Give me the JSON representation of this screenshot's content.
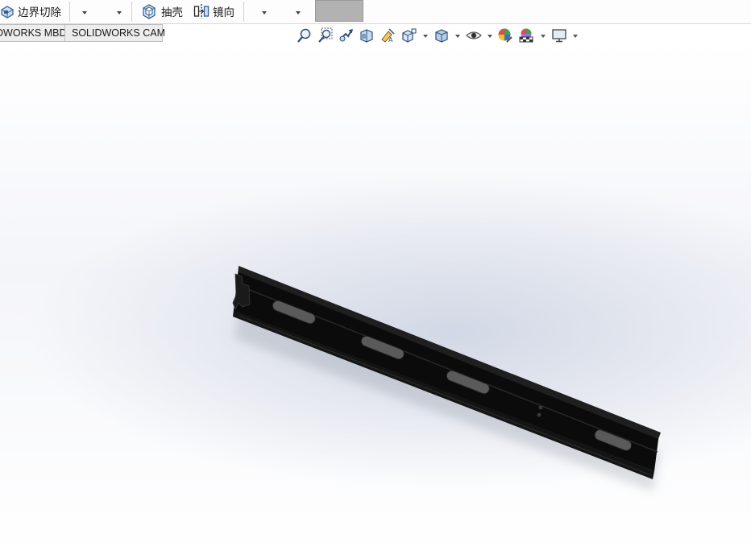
{
  "ribbon": {
    "boundary_cut_label": "边界切除",
    "shell_label": "抽壳",
    "mirror_label": "镜向"
  },
  "tabs": {
    "mbd_label": "DWORKS MBD",
    "cam_label": "SOLIDWORKS CAM"
  },
  "icons": {
    "boundary_cut": "boundary-cut-icon",
    "shell": "shell-icon",
    "mirror": "mirror-icon",
    "view_toolbar": [
      "zoom-to-fit-icon",
      "zoom-to-area-icon",
      "previous-view-icon",
      "section-view-icon",
      "dynamic-annotation-icon",
      "view-orientation-icon",
      "display-style-icon",
      "hide-show-items-icon",
      "edit-appearance-icon",
      "apply-scene-icon",
      "view-settings-icon"
    ]
  },
  "colors": {
    "model": "#0b0b0b",
    "viewport_shade": "#d0d6e4",
    "gray_button": "#b2b2b2"
  }
}
